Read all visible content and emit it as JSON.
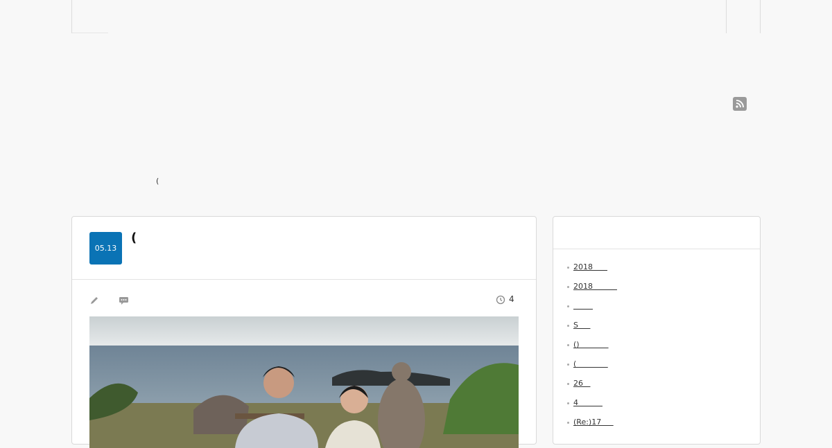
{
  "header": {
    "description": "("
  },
  "post": {
    "date": "05.13",
    "title": "(",
    "view_count": "4"
  },
  "sidebar": {
    "items": [
      {
        "label": "2018      "
      },
      {
        "label": "2018          "
      },
      {
        "label": "        "
      },
      {
        "label": "S     "
      },
      {
        "label": "()            "
      },
      {
        "label": "(             "
      },
      {
        "label": "26   "
      },
      {
        "label": "4          "
      },
      {
        "label": "(Re:)17     "
      }
    ]
  },
  "colors": {
    "accent": "#0a73b5",
    "background": "#f8f8f8",
    "icon_gray": "#9a9a9a"
  },
  "icons": {
    "rss": "rss-icon",
    "edit": "pencil-icon",
    "comment": "comment-icon",
    "time": "clock-icon"
  }
}
